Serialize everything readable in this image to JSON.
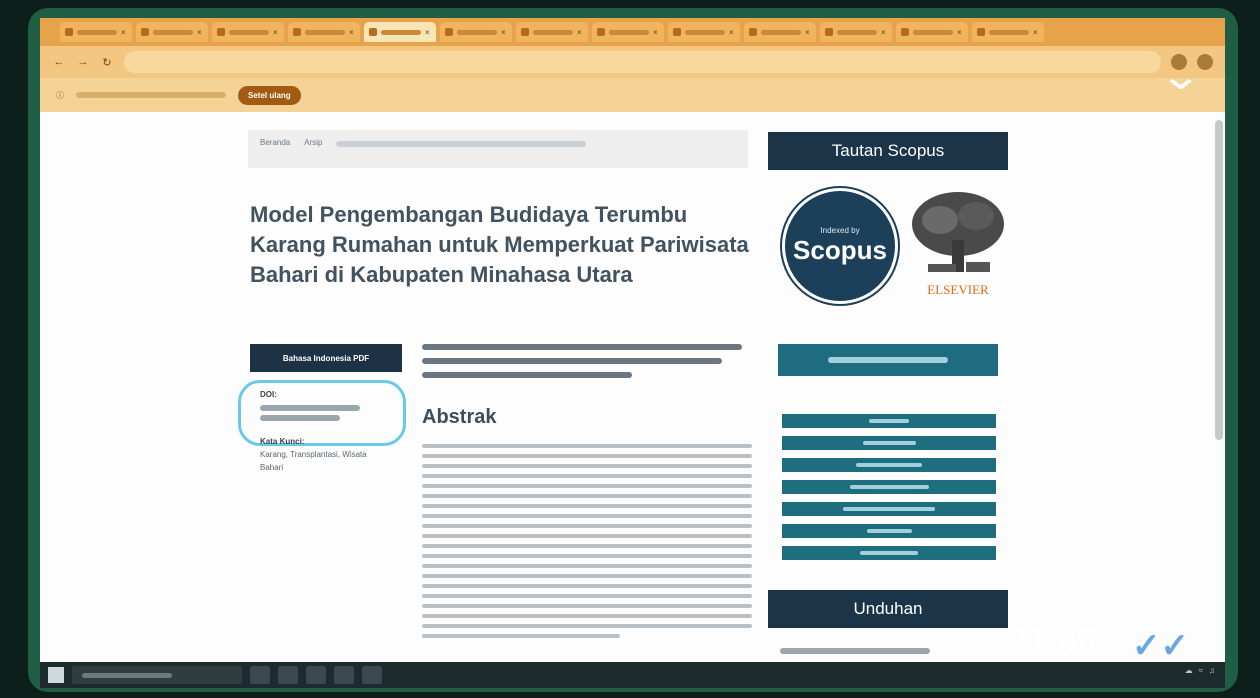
{
  "browser": {
    "tabs": [
      {
        "label": "",
        "active": false
      },
      {
        "label": "",
        "active": false
      },
      {
        "label": "",
        "active": false
      },
      {
        "label": "",
        "active": false
      },
      {
        "label": "",
        "active": true
      },
      {
        "label": "",
        "active": false
      },
      {
        "label": "",
        "active": false
      },
      {
        "label": "",
        "active": false
      },
      {
        "label": "",
        "active": false
      },
      {
        "label": "",
        "active": false
      },
      {
        "label": "",
        "active": false
      },
      {
        "label": "",
        "active": false
      },
      {
        "label": "",
        "active": false
      }
    ],
    "infobar_button": "Setel ulang"
  },
  "page": {
    "breadcrumb": [
      "Beranda",
      "Arsip"
    ],
    "title": "Model Pengembangan Budidaya Terumbu Karang Rumahan untuk Memperkuat Pariwisata Bahari di Kabupaten Minahasa Utara",
    "pdf_button": "Bahasa Indonesia PDF",
    "doi_label": "DOI:",
    "keywords_label": "Kata Kunci:",
    "keywords": "Karang, Transplantasi, Wisata Bahari",
    "abstract_heading": "Abstrak"
  },
  "sidebar": {
    "scopus_heading": "Tautan Scopus",
    "scopus_small": "Indexed by",
    "scopus_big": "Scopus",
    "elsevier": "ELSEVIER",
    "unduhan_heading": "Unduhan"
  },
  "overlay": {
    "clock": "21.46"
  },
  "colors": {
    "accent_navy": "#1c3447",
    "accent_teal": "#1f6b80",
    "highlight_circle": "#6bc8ea",
    "elsevier_orange": "#e06a1a"
  }
}
